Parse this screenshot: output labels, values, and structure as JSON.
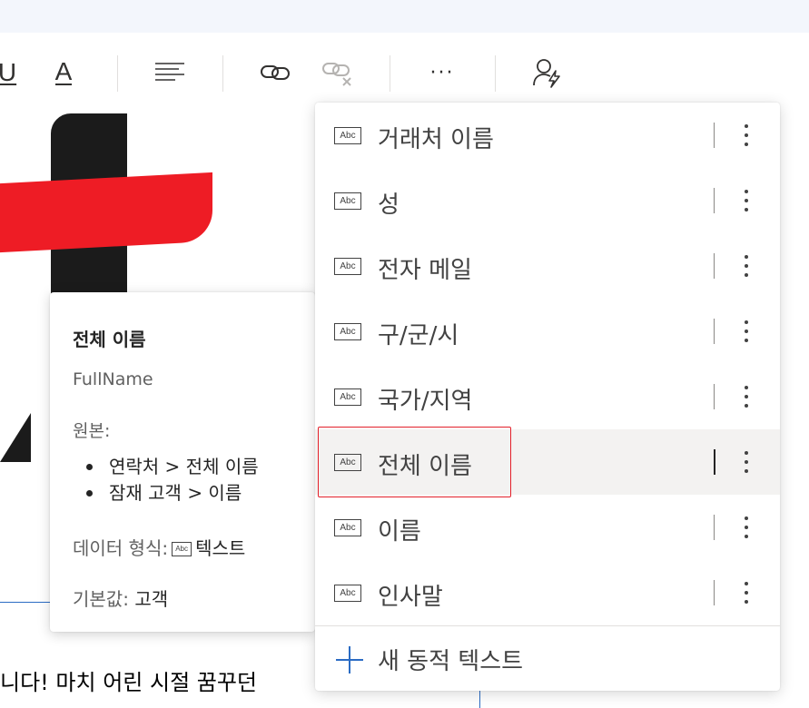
{
  "toolbar": {
    "underline_glyph": "U",
    "fontcolor_glyph": "A",
    "more_glyph": "···"
  },
  "tooltip": {
    "title": "전체 이름",
    "field_name": "FullName",
    "source_label": "원본:",
    "sources": [
      "연락처 > 전체 이름",
      "잠재 고객 > 이름"
    ],
    "data_type_label": "데이터 형식:",
    "data_type_icon_text": "Abc",
    "data_type_value": "텍스트",
    "default_label": "기본값:",
    "default_value": "고객"
  },
  "dropdown": {
    "icon_text": "Abc",
    "items": [
      {
        "label": "거래처 이름"
      },
      {
        "label": "성"
      },
      {
        "label": "전자 메일"
      },
      {
        "label": "구/군/시"
      },
      {
        "label": "국가/지역"
      },
      {
        "label": "전체 이름",
        "selected": true
      },
      {
        "label": "이름"
      },
      {
        "label": "인사말"
      }
    ],
    "new_label": "새 동적 텍스트"
  },
  "canvas": {
    "body_text": "니다! 마치 어린 시절 꿈꾸던"
  }
}
